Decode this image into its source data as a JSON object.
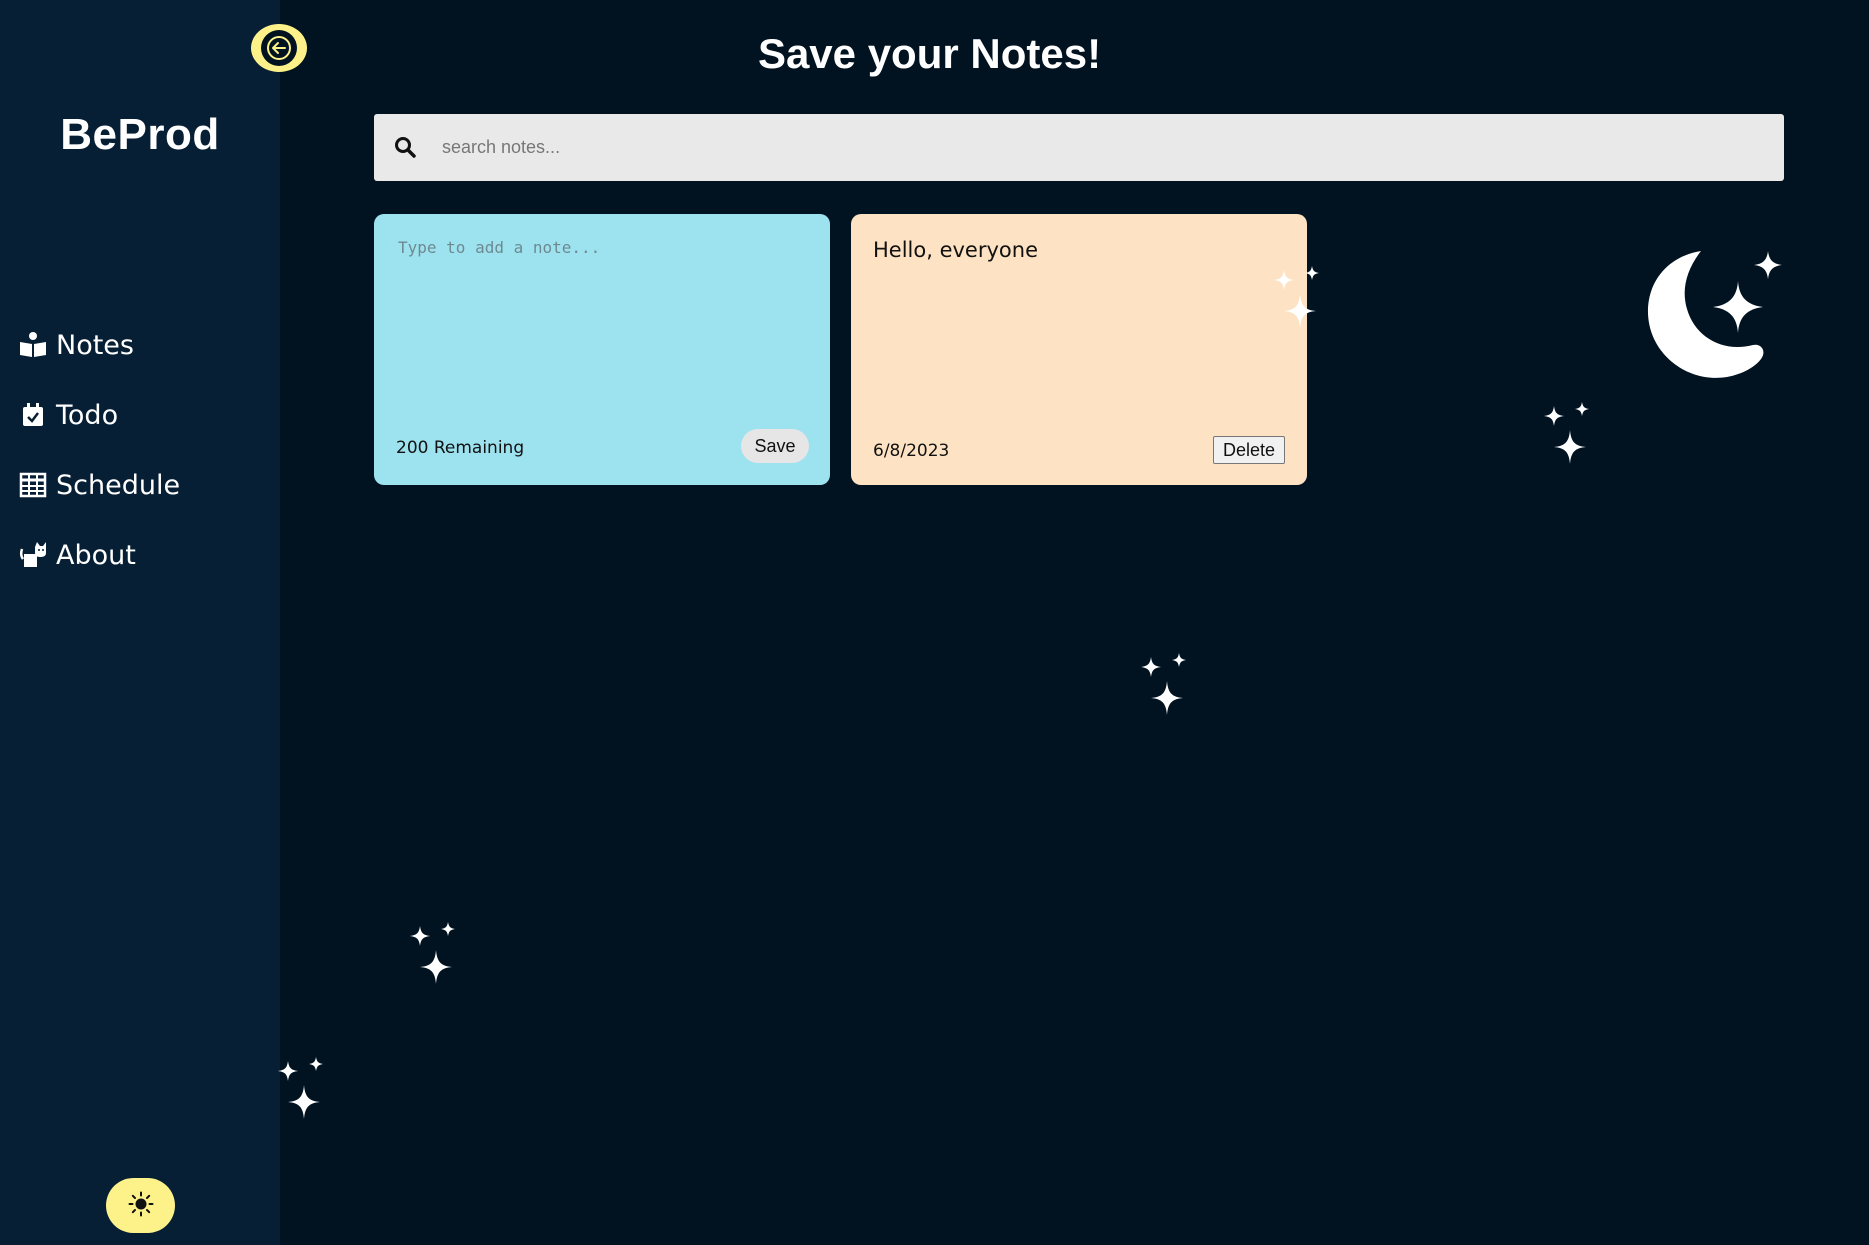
{
  "sidebar": {
    "brand": "BeProd",
    "items": [
      {
        "label": "Notes",
        "icon": "reading-book-icon"
      },
      {
        "label": "Todo",
        "icon": "calendar-check-icon"
      },
      {
        "label": "Schedule",
        "icon": "table-grid-icon"
      },
      {
        "label": "About",
        "icon": "cat-icon"
      }
    ],
    "collapse_icon": "arrow-left-icon",
    "theme_icon": "sun-icon"
  },
  "main": {
    "title": "Save your Notes!",
    "search": {
      "placeholder": "search notes..."
    },
    "new_note": {
      "placeholder": "Type to add a note...",
      "remaining": "200 Remaining",
      "save_label": "Save"
    },
    "notes": [
      {
        "text": "Hello, everyone",
        "date": "6/8/2023",
        "delete_label": "Delete"
      }
    ]
  },
  "colors": {
    "background": "#011220",
    "sidebar": "#071f35",
    "accent_yellow": "#fdf28a",
    "new_note": "#9de2ef",
    "existing_note": "#fde3c3"
  }
}
